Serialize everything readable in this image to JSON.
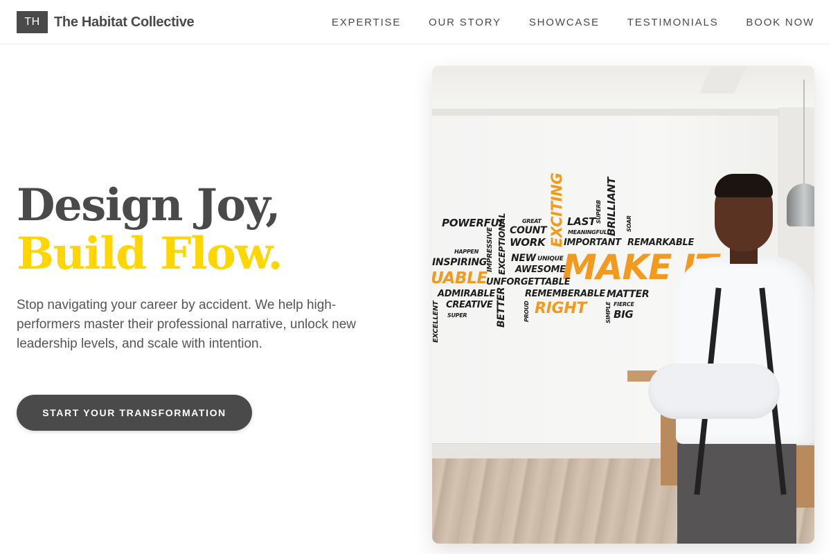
{
  "header": {
    "logo_mark": "TH",
    "brand_name": "The Habitat Collective",
    "nav": [
      {
        "label": "EXPERTISE"
      },
      {
        "label": "OUR STORY"
      },
      {
        "label": "SHOWCASE"
      },
      {
        "label": "TESTIMONIALS"
      },
      {
        "label": "BOOK NOW"
      }
    ]
  },
  "hero": {
    "title_line1": "Design Joy,",
    "title_line2": "Build Flow.",
    "subtitle": "Stop navigating your career by accident. We help high-performers master their professional narrative, unlock new leadership levels, and scale with intention.",
    "cta_label": "START YOUR TRANSFORMATION",
    "image": {
      "wall_words": {
        "powerful": "POWERFUL",
        "great": "GREAT",
        "count": "COUNT",
        "work": "WORK",
        "exciting": "EXCITING",
        "last": "LAST",
        "superb": "SUPERB",
        "meaningful": "MEANINGFUL",
        "important": "IMPORTANT",
        "brilliant": "BRILLIANT",
        "soar": "SOAR",
        "remarkable": "REMARKABLE",
        "happen": "HAPPEN",
        "inspiring": "INSPIRING",
        "impressive": "IMPRESSIVE",
        "exceptional": "EXCEPTIONAL",
        "new": "NEW",
        "unique": "UNIQUE",
        "awesome": "AWESOME",
        "make_it": "MAKE IT",
        "uable": "UABLE",
        "unforgettable": "UNFORGETTABLE",
        "admirable": "ADMIRABLE",
        "creative": "CREATIVE",
        "super": "SUPER",
        "better": "BETTER",
        "rememberable": "REMEMBERABLE",
        "matter": "MATTER",
        "proud": "PROUD",
        "right": "RIGHT",
        "simple": "SIMPLE",
        "fierce": "FIERCE",
        "big": "BIG",
        "excellent": "EXCELLENT"
      },
      "accent_color": "#f29a1e"
    }
  },
  "colors": {
    "primary": "#4a4a4a",
    "accent": "#ffd600",
    "text_muted": "#555555"
  }
}
